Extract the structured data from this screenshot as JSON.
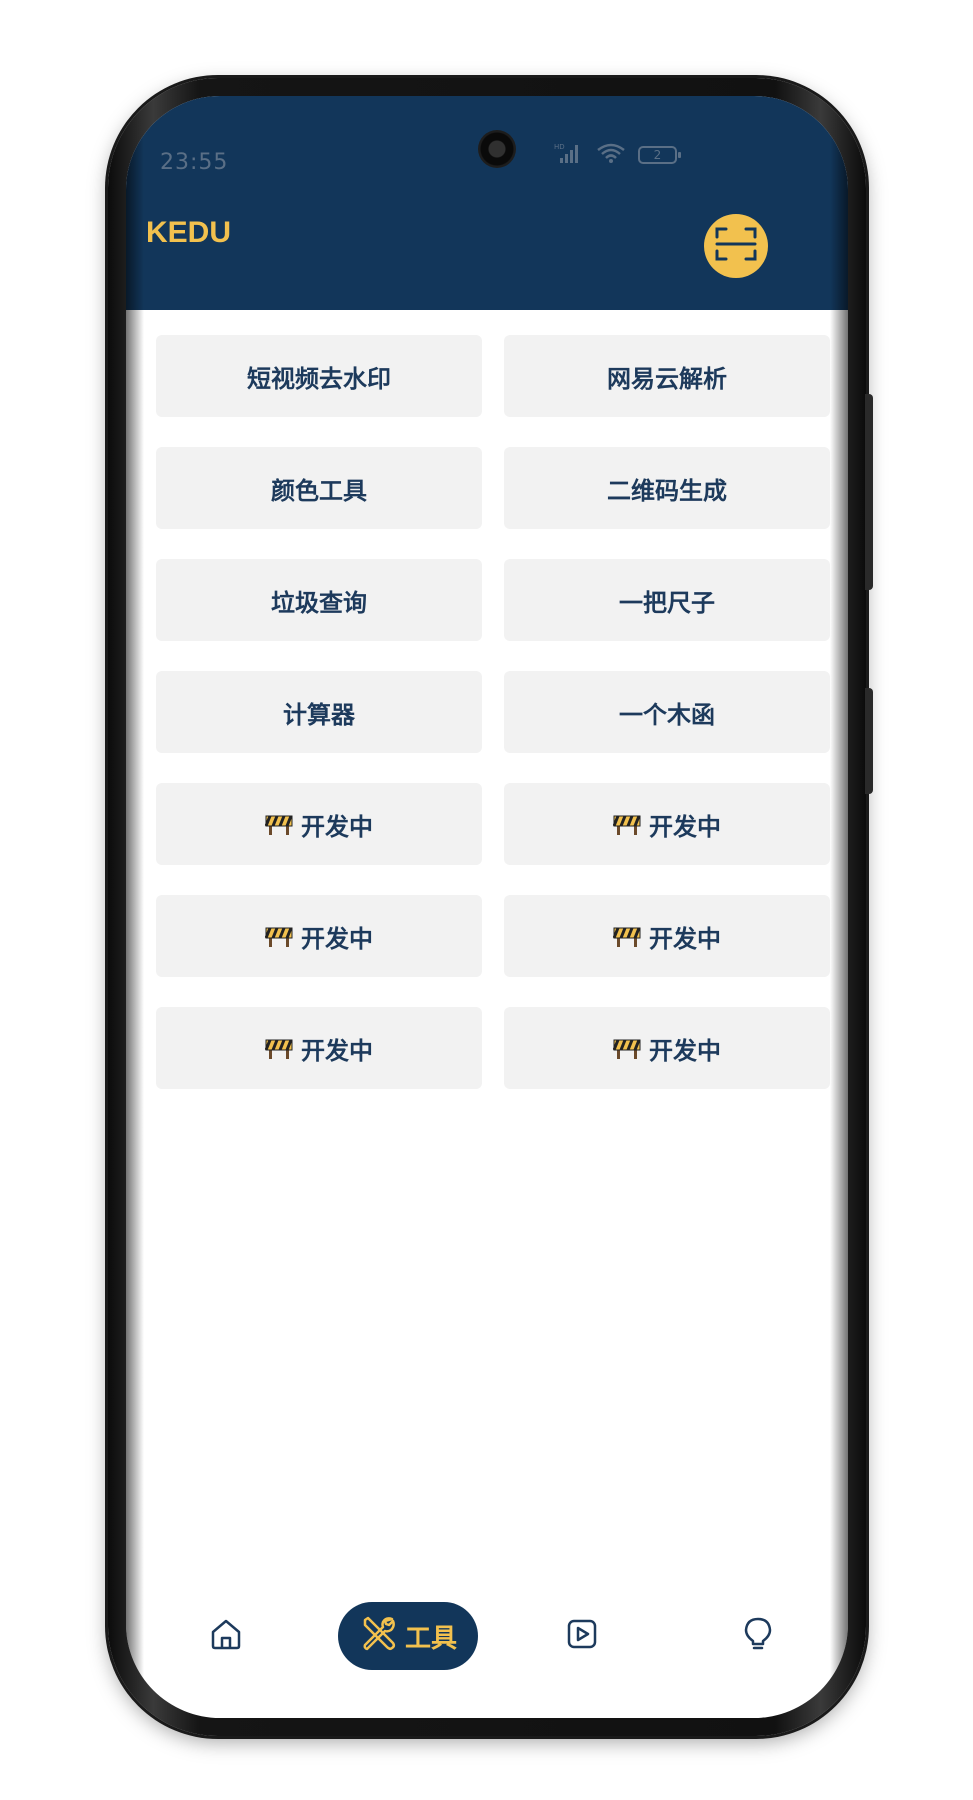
{
  "status_bar": {
    "time": "23:55",
    "network_label": "HD",
    "battery_level": "2"
  },
  "header": {
    "app_title": "KEDU",
    "scan_icon": "scan-frame-icon"
  },
  "tools": [
    {
      "label": "短视频去水印",
      "wip": false
    },
    {
      "label": "网易云解析",
      "wip": false
    },
    {
      "label": "颜色工具",
      "wip": false
    },
    {
      "label": "二维码生成",
      "wip": false
    },
    {
      "label": "垃圾查询",
      "wip": false
    },
    {
      "label": "一把尺子",
      "wip": false
    },
    {
      "label": "计算器",
      "wip": false
    },
    {
      "label": "一个木函",
      "wip": false
    },
    {
      "label": "开发中",
      "wip": true
    },
    {
      "label": "开发中",
      "wip": true
    },
    {
      "label": "开发中",
      "wip": true
    },
    {
      "label": "开发中",
      "wip": true
    },
    {
      "label": "开发中",
      "wip": true
    },
    {
      "label": "开发中",
      "wip": true
    }
  ],
  "bottom_nav": {
    "home_icon": "home-icon",
    "tools_icon": "tools-icon",
    "tools_label": "工具",
    "video_icon": "video-play-icon",
    "ideas_icon": "lightbulb-icon",
    "active": "tools"
  },
  "colors": {
    "header_bg": "#12365a",
    "accent": "#f2c14e",
    "card_bg": "#f2f2f2",
    "card_text": "#1d3a5c"
  }
}
